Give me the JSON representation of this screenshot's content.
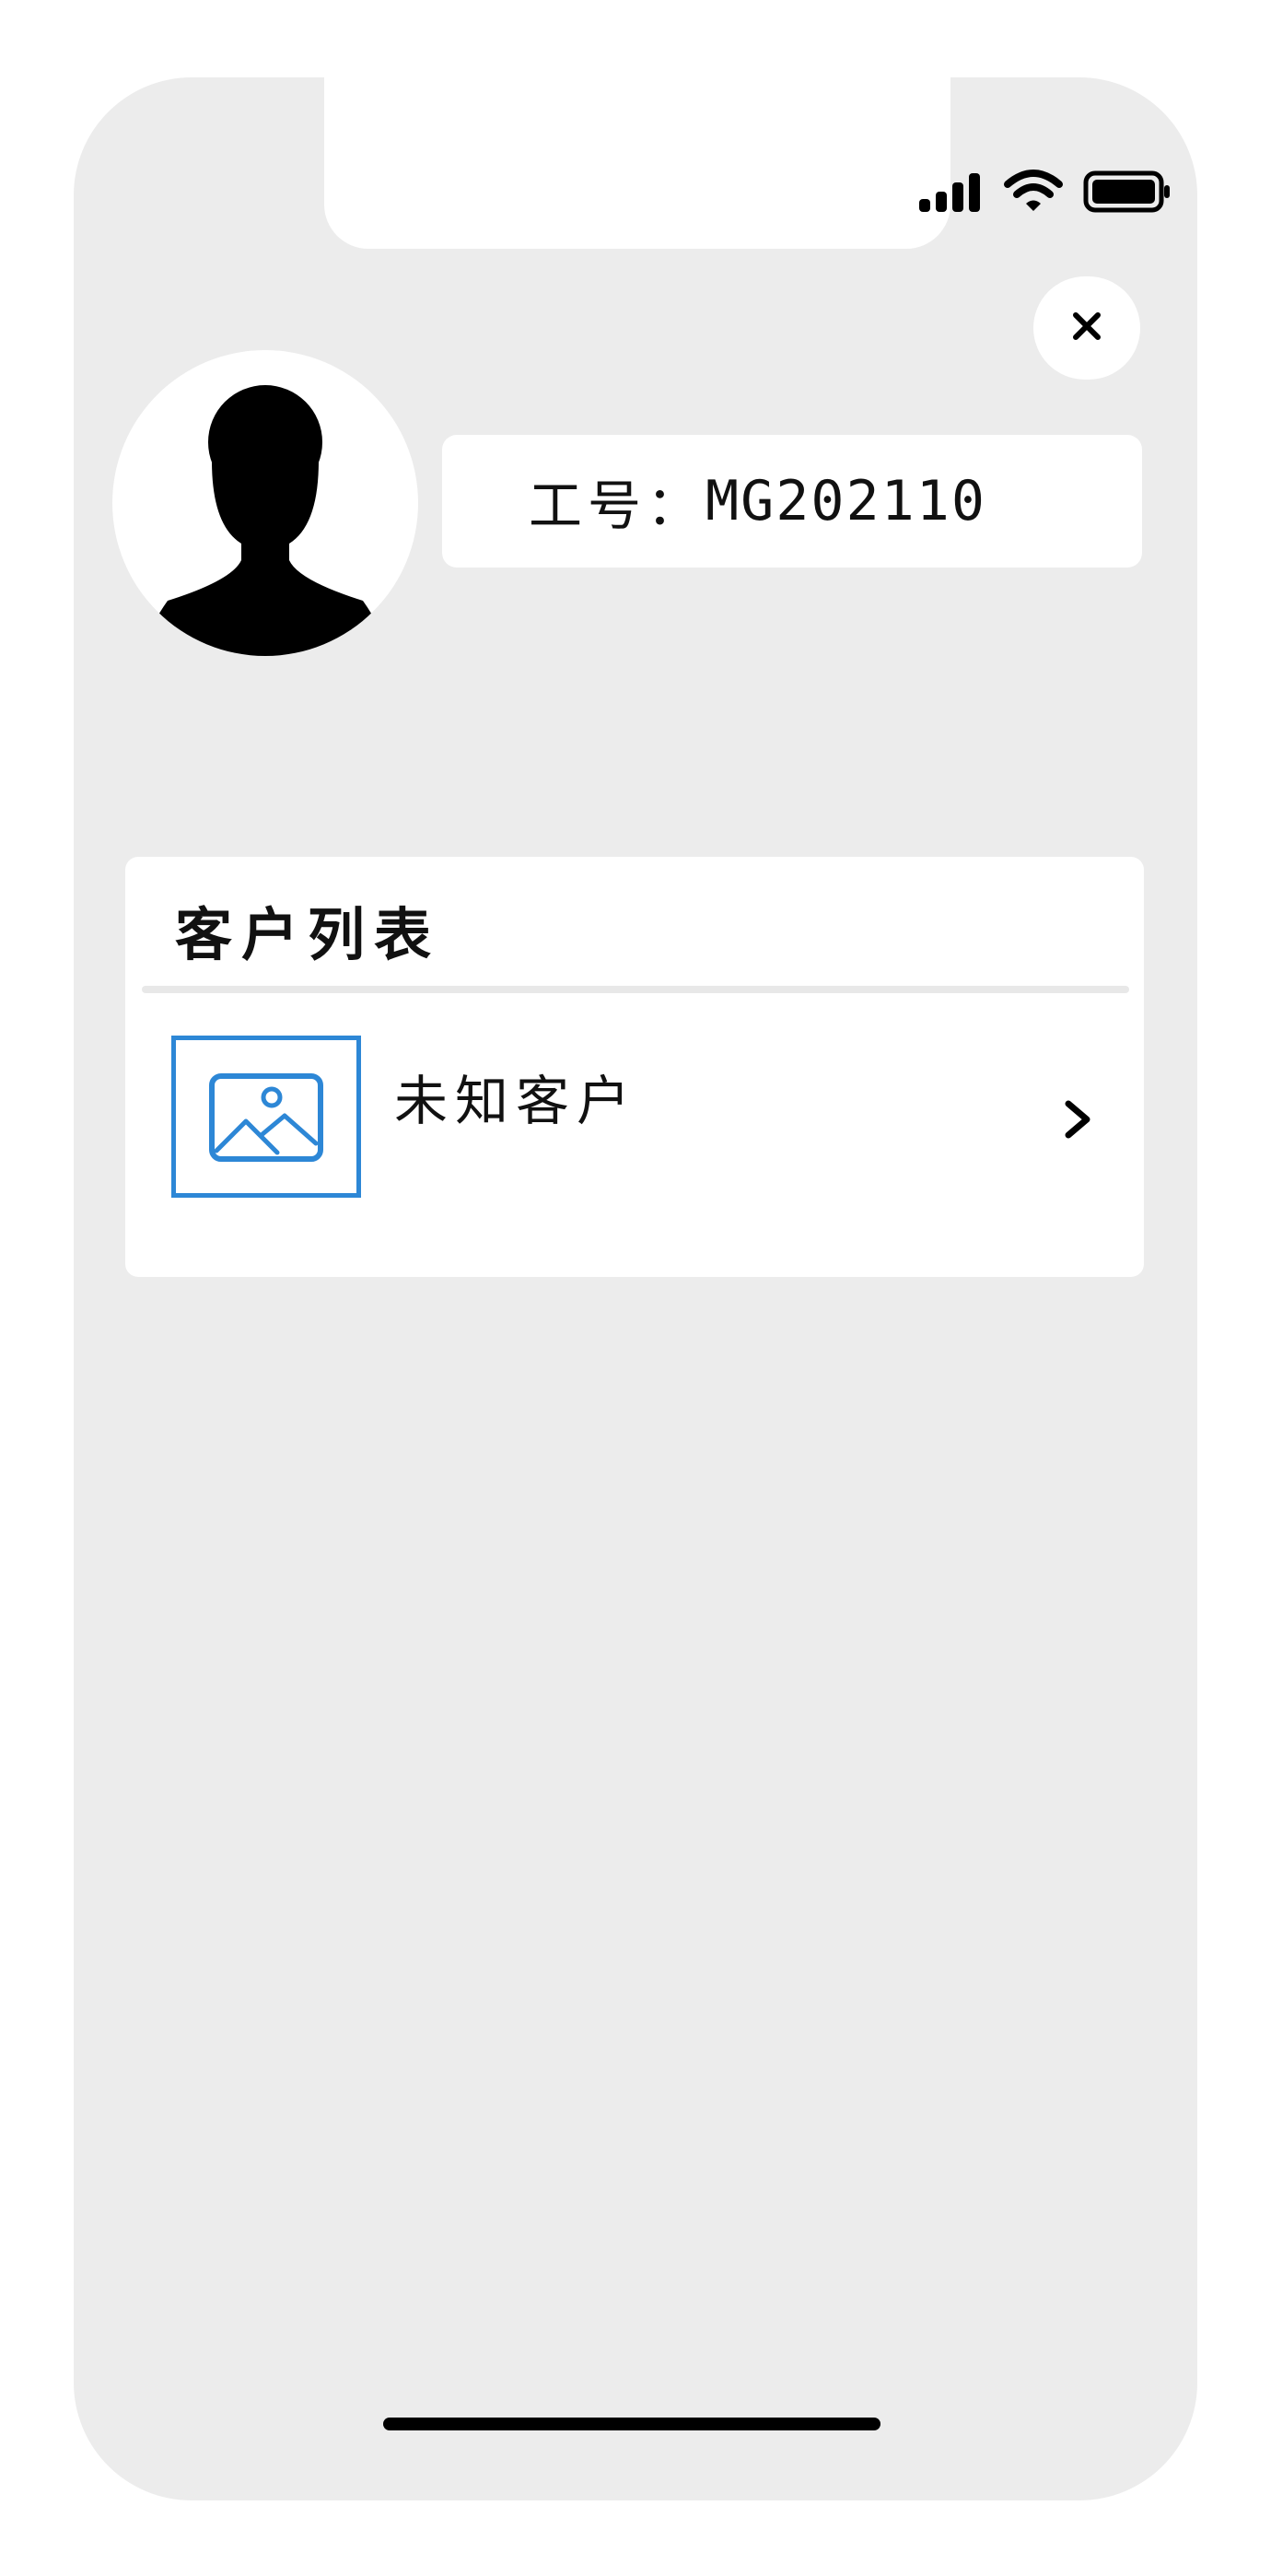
{
  "status_bar": {
    "signal_icon": "cellular-signal-icon",
    "wifi_icon": "wifi-icon",
    "battery_icon": "battery-icon"
  },
  "profile": {
    "avatar_icon": "person-silhouette-icon",
    "id_label": "工号：",
    "id_value": "MG202110",
    "close_icon": "close-icon"
  },
  "customer_list": {
    "title": "客户列表",
    "items": [
      {
        "name": "未知客户",
        "thumbnail_icon": "image-placeholder-icon",
        "arrow_icon": "chevron-right-icon"
      }
    ]
  },
  "colors": {
    "background": "#ececec",
    "card": "#ffffff",
    "accent": "#2d87d6",
    "text": "#111111"
  }
}
